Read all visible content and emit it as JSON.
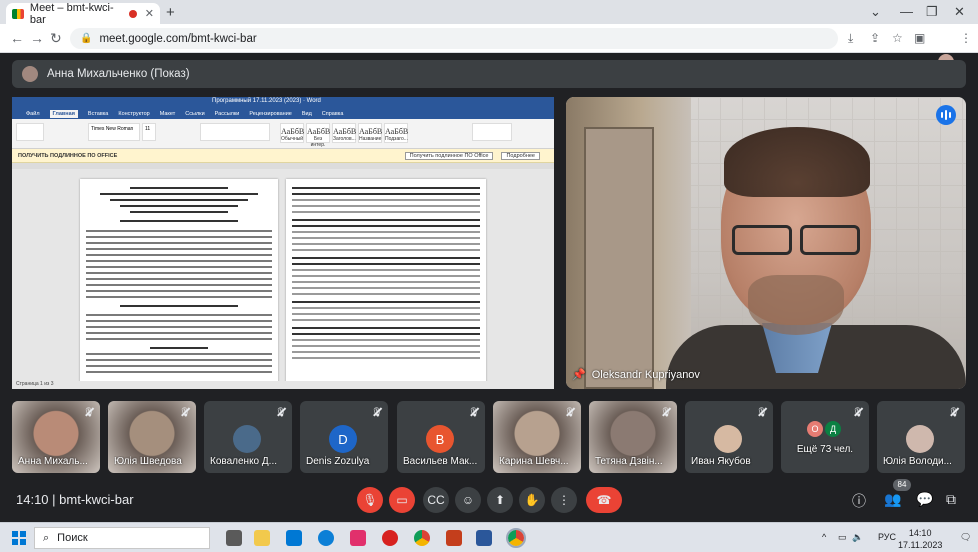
{
  "browser": {
    "tab_title": "Meet – bmt-kwci-bar",
    "url": "meet.google.com/bmt-kwci-bar"
  },
  "presenter": {
    "label": "Анна Михальченко (Показ)"
  },
  "document": {
    "window_title": "Программный 17.11.2023 (2023) · Word",
    "menu": [
      "Файл",
      "Главная",
      "Вставка",
      "Конструктор",
      "Макет",
      "Ссылки",
      "Рассылки",
      "Рецензирование",
      "Вид",
      "Справка"
    ],
    "font": "Times New Roman",
    "size": "11",
    "style_names": [
      "Обычный",
      "Без интер.",
      "Заголов...",
      "Название",
      "Подзаго..."
    ],
    "infobar_text": "ПОЛУЧИТЬ ПОДЛИННОЕ ПО OFFICE",
    "infobar_buttons": [
      "Получить подлинное ПО Office",
      "Подробнее"
    ],
    "status": "Страница 1 из 3"
  },
  "speaker": {
    "name": "Oleksandr Kupriyanov"
  },
  "participants": [
    {
      "name": "Анна Михаль...",
      "type": "photo",
      "color": "#b98b77"
    },
    {
      "name": "Юлія Шведова",
      "type": "photo",
      "color": "#a58f7d"
    },
    {
      "name": "Коваленко Д...",
      "type": "photo-small",
      "color": "#4a6a8a"
    },
    {
      "name": "Denis Zozulya",
      "type": "letter",
      "letter": "D",
      "color": "#1e66c8"
    },
    {
      "name": "Васильев Мак...",
      "type": "letter",
      "letter": "В",
      "color": "#e8552f"
    },
    {
      "name": "Карина Шевч...",
      "type": "photo",
      "color": "#b7a18f"
    },
    {
      "name": "Тетяна Дзвін...",
      "type": "photo",
      "color": "#8b7a72"
    },
    {
      "name": "Иван Якубов",
      "type": "photo-small",
      "color": "#d6b9a2"
    },
    {
      "name": "Ещё 73 чел.",
      "type": "more",
      "letters": [
        "О",
        "Д"
      ]
    },
    {
      "name": "Юлія Володи...",
      "type": "photo-small",
      "color": "#cfb8ad"
    }
  ],
  "meeting": {
    "time": "14:10",
    "code": "bmt-kwci-bar",
    "people_count": "84"
  },
  "taskbar": {
    "search": "Поиск",
    "lang": "РУС",
    "time": "14:10",
    "date": "17.11.2023"
  }
}
